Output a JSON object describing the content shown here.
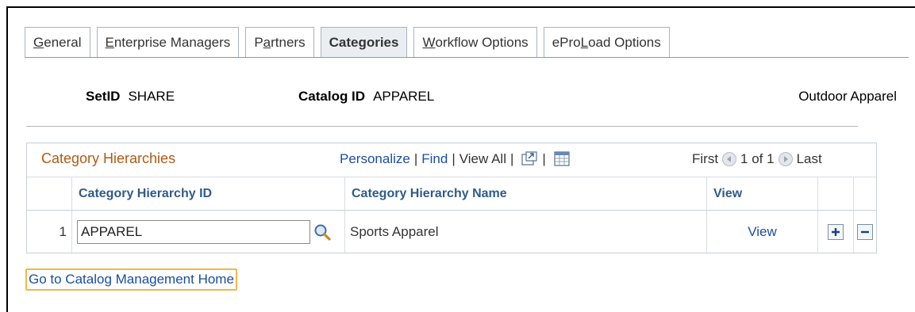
{
  "tabs": [
    {
      "prefix": "",
      "accel": "G",
      "rest": "eneral",
      "active": false
    },
    {
      "prefix": "",
      "accel": "E",
      "rest": "nterprise Managers",
      "active": false
    },
    {
      "prefix": "P",
      "accel": "a",
      "rest": "rtners",
      "active": false
    },
    {
      "prefix": "Categories",
      "accel": "",
      "rest": "",
      "active": true
    },
    {
      "prefix": "",
      "accel": "W",
      "rest": "orkflow Options",
      "active": false
    },
    {
      "prefix": "ePro ",
      "accel": "L",
      "rest": "oad Options",
      "active": false
    }
  ],
  "header": {
    "setid_label": "SetID",
    "setid_value": "SHARE",
    "catalog_label": "Catalog ID",
    "catalog_value": "APPAREL",
    "catalog_desc": "Outdoor Apparel"
  },
  "grid": {
    "title": "Category Hierarchies",
    "personalize": "Personalize",
    "find": "Find",
    "view_all": "View All",
    "pager_first": "First",
    "pager_range": "1 of 1",
    "pager_last": "Last",
    "columns": {
      "id": "Category Hierarchy ID",
      "name": "Category Hierarchy Name",
      "view": "View"
    },
    "rows": [
      {
        "num": "1",
        "id": "APPAREL",
        "name": "Sports Apparel",
        "view": "View"
      }
    ]
  },
  "footer": {
    "home_link": "Go to Catalog Management Home"
  },
  "colors": {
    "link": "#1a4ea1",
    "grid_title": "#b25a16",
    "column_header": "#305b8a",
    "focus_border": "#f0b84a"
  }
}
